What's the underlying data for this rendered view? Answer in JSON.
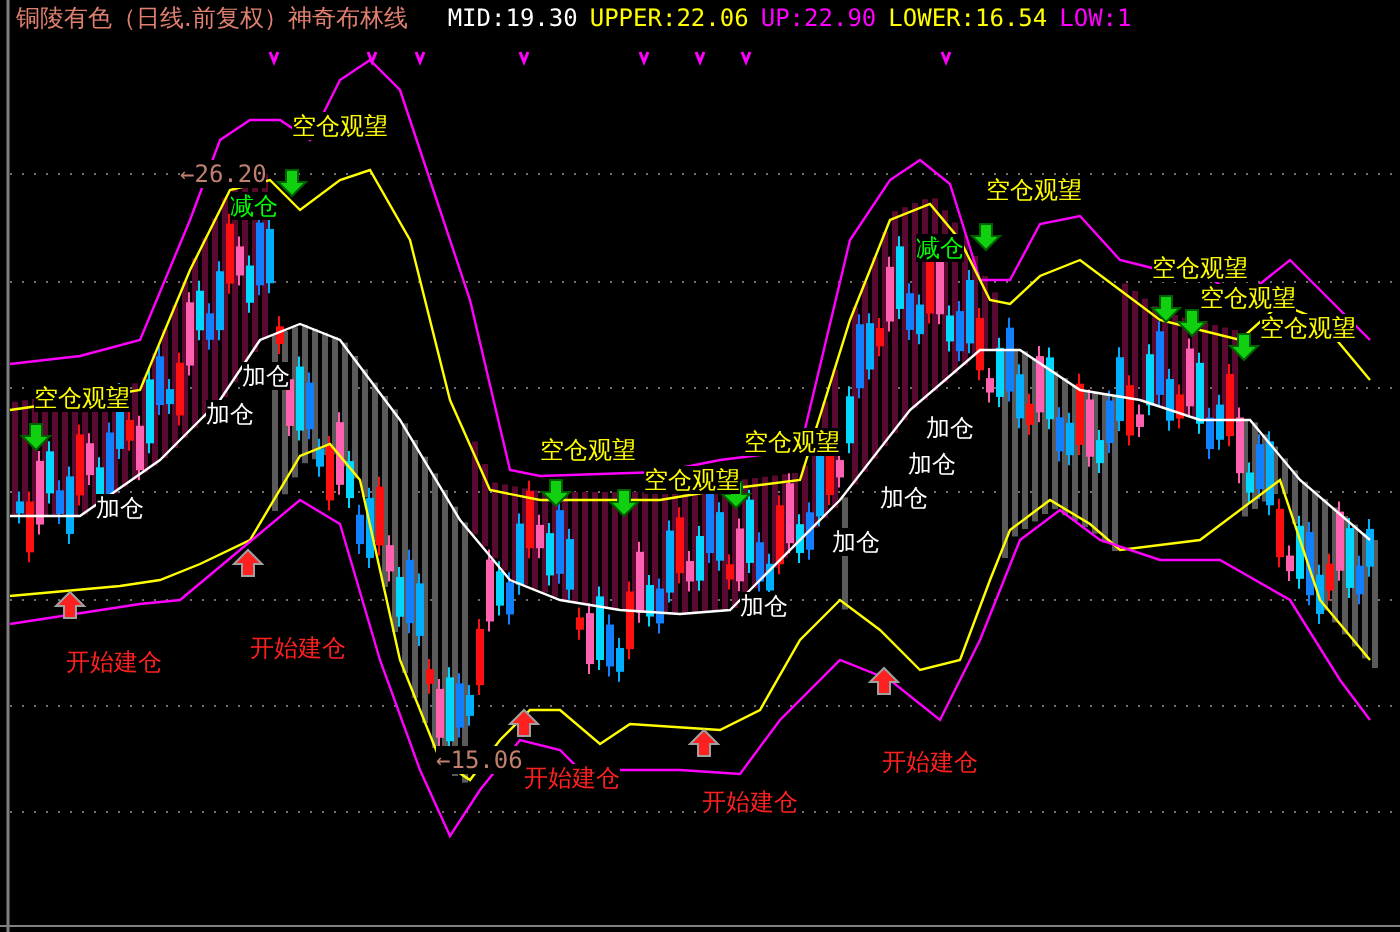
{
  "chart_title": "铜陵有色（日线.前复权）神奇布林线",
  "indicators": [
    {
      "text": "MID:19.30",
      "color": "#ffffff"
    },
    {
      "text": "UPPER:22.06",
      "color": "#ffff00"
    },
    {
      "text": "UP:22.90",
      "color": "#ff00ff"
    },
    {
      "text": "LOWER:16.54",
      "color": "#ffff00"
    },
    {
      "text": "LOW:1",
      "color": "#ff00ff"
    }
  ],
  "price_marks": [
    {
      "text": "←26.20"
    },
    {
      "text": "←15.06"
    }
  ],
  "signals": [
    {
      "kind": "watch",
      "text": "空仓观望"
    },
    {
      "kind": "watch",
      "text": "空仓观望"
    },
    {
      "kind": "watch",
      "text": "空仓观望"
    },
    {
      "kind": "watch",
      "text": "空仓观望"
    },
    {
      "kind": "watch",
      "text": "空仓观望"
    },
    {
      "kind": "watch",
      "text": "空仓观望"
    },
    {
      "kind": "watch",
      "text": "空仓观望"
    },
    {
      "kind": "watch",
      "text": "空仓观望"
    },
    {
      "kind": "watch",
      "text": "空仓观望"
    },
    {
      "kind": "reduce",
      "text": "减仓"
    },
    {
      "kind": "reduce",
      "text": "减仓"
    },
    {
      "kind": "add",
      "text": "加仓"
    },
    {
      "kind": "add",
      "text": "加仓"
    },
    {
      "kind": "add",
      "text": "加仓"
    },
    {
      "kind": "add",
      "text": "加仓"
    },
    {
      "kind": "add",
      "text": "加仓"
    },
    {
      "kind": "add",
      "text": "加仓"
    },
    {
      "kind": "add",
      "text": "加仓"
    },
    {
      "kind": "add",
      "text": "加仓"
    },
    {
      "kind": "start",
      "text": "开始建仓"
    },
    {
      "kind": "start",
      "text": "开始建仓"
    },
    {
      "kind": "start",
      "text": "开始建仓"
    },
    {
      "kind": "start",
      "text": "开始建仓"
    },
    {
      "kind": "start",
      "text": "开始建仓"
    }
  ]
}
